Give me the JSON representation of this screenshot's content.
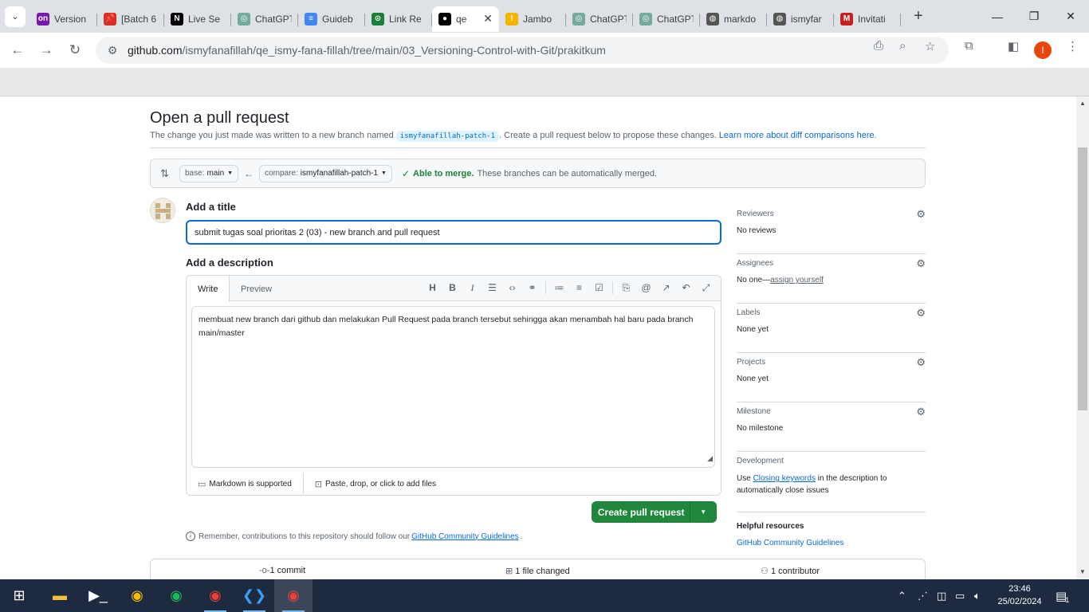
{
  "browser": {
    "tabs": [
      {
        "title": "Version",
        "icon": "onenote-icon",
        "color": "#7719aa",
        "glyph": "on"
      },
      {
        "title": "[Batch 6",
        "icon": "pin-icon",
        "color": "#d93025",
        "glyph": "📌"
      },
      {
        "title": "Live Se",
        "icon": "notion-icon",
        "color": "#000000",
        "glyph": "N"
      },
      {
        "title": "ChatGPT",
        "icon": "chatgpt-icon",
        "color": "#74aa9c",
        "glyph": "◎"
      },
      {
        "title": "Guideb",
        "icon": "docs-icon",
        "color": "#4285f4",
        "glyph": "≡"
      },
      {
        "title": "Link Re",
        "icon": "link-icon",
        "color": "#188038",
        "glyph": "⊙"
      },
      {
        "title": "qe",
        "icon": "github-icon",
        "color": "#000000",
        "glyph": "●",
        "active": true
      },
      {
        "title": "Jambo",
        "icon": "jambo-icon",
        "color": "#f4b400",
        "glyph": "!"
      },
      {
        "title": "ChatGPT",
        "icon": "chatgpt-icon",
        "color": "#74aa9c",
        "glyph": "◎"
      },
      {
        "title": "ChatGPT",
        "icon": "chatgpt-icon",
        "color": "#74aa9c",
        "glyph": "◎"
      },
      {
        "title": "markdo",
        "icon": "github-icon",
        "color": "#555555",
        "glyph": "◍"
      },
      {
        "title": "ismyfar",
        "icon": "github-icon",
        "color": "#555555",
        "glyph": "◍"
      },
      {
        "title": "Invitati",
        "icon": "gmail-icon",
        "color": "#c5221f",
        "glyph": "M"
      }
    ],
    "url_host": "github.com",
    "url_path": "/ismyfanafillah/qe_ismy-fana-fillah/tree/main/03_Versioning-Control-with-Git/prakitkum",
    "profile_initial": "I"
  },
  "page": {
    "heading": "Open a pull request",
    "sub_before": "The change you just made was written to a new branch named",
    "branch_name": "ismyfanafillah-patch-1",
    "sub_after": ". Create a pull request below to propose these changes.",
    "sub_link": "Learn more about diff comparisons here.",
    "base_prefix": "base:",
    "base_branch": "main",
    "compare_prefix": "compare:",
    "compare_branch": "ismyfanafillah-patch-1",
    "merge_status": "Able to merge.",
    "merge_detail": "These branches can be automatically merged.",
    "title_label": "Add a title",
    "title_value": "submit tugas soal prioritas 2 (03) - new branch and pull request",
    "desc_label": "Add a description",
    "tab_write": "Write",
    "tab_preview": "Preview",
    "description": "membuat new branch dari github dan melakukan  Pull Request pada branch tersebut sehingga akan menambah hal baru pada branch main/master",
    "markdown_note": "Markdown is supported",
    "attach_note": "Paste, drop, or click to add files",
    "create_button": "Create pull request",
    "remember_before": "Remember, contributions to this repository should follow our",
    "remember_link": "GitHub Community Guidelines",
    "remember_after": ".",
    "stats": {
      "commits": "1 commit",
      "files": "1 file changed",
      "contributors": "1 contributor"
    }
  },
  "sidebar": {
    "reviewers": {
      "label": "Reviewers",
      "value": "No reviews"
    },
    "assignees": {
      "label": "Assignees",
      "value_before": "No one—",
      "value_link": "assign yourself"
    },
    "labels": {
      "label": "Labels",
      "value": "None yet"
    },
    "projects": {
      "label": "Projects",
      "value": "None yet"
    },
    "milestone": {
      "label": "Milestone",
      "value": "No milestone"
    },
    "development": {
      "label": "Development",
      "before": "Use",
      "link": "Closing keywords",
      "after": "in the description to automatically close issues"
    },
    "help": {
      "label": "Helpful resources",
      "link": "GitHub Community Guidelines"
    }
  },
  "taskbar": {
    "time": "23:46",
    "date": "25/02/2024",
    "notifications": "1"
  }
}
